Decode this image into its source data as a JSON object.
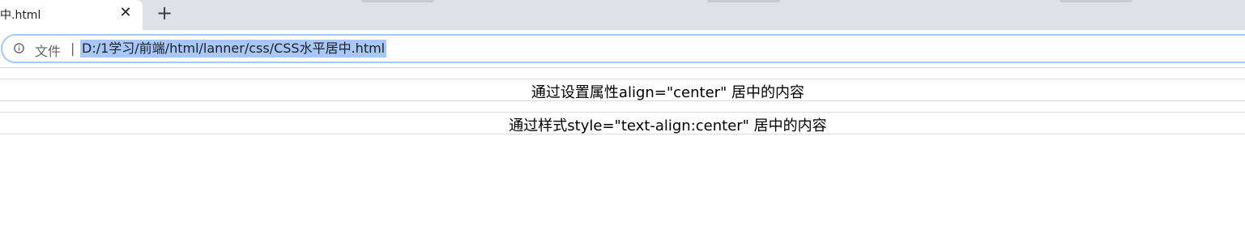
{
  "browser": {
    "tab": {
      "title": "中.html",
      "close_glyph": "✕"
    },
    "new_tab_glyph": "+",
    "address_bar": {
      "scheme_label": "文件",
      "separator": "|",
      "url": "D:/1学习/前端/html/lanner/css/CSS水平居中.html"
    }
  },
  "page": {
    "line1": "通过设置属性align=\"center\" 居中的内容",
    "line2": "通过样式style=\"text-align:center\" 居中的内容"
  }
}
